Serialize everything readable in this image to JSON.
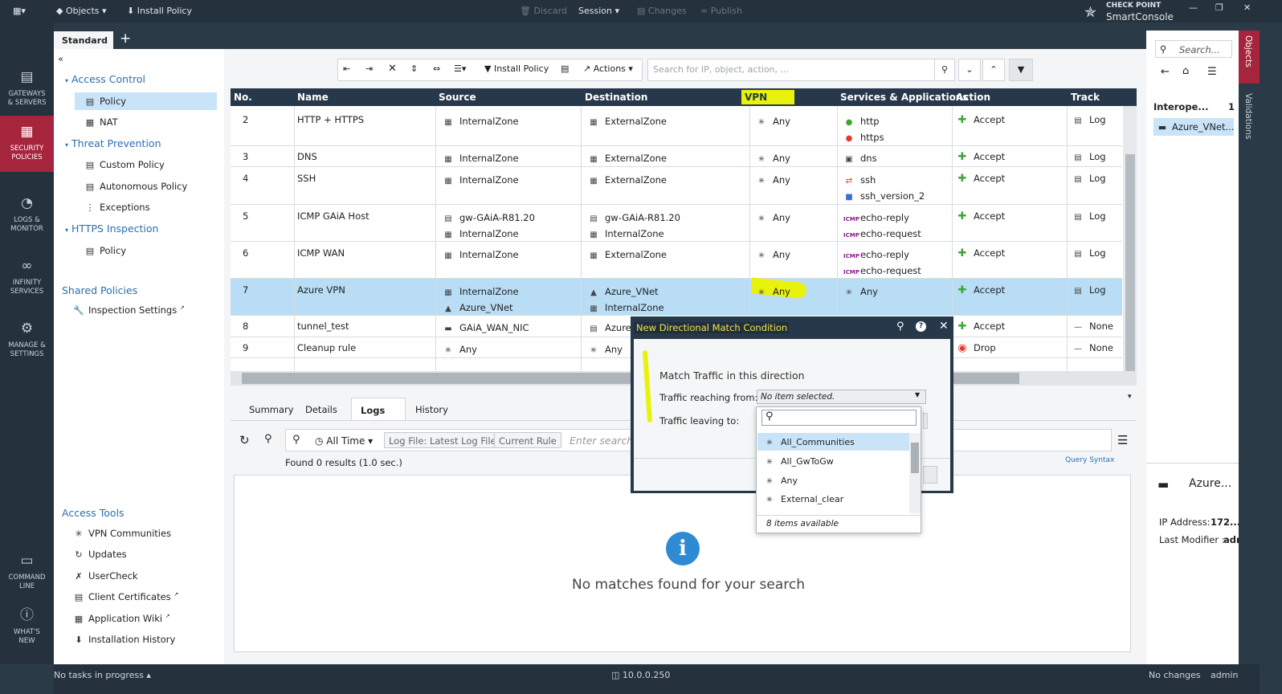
{
  "topbar": {
    "objects": "Objects",
    "install_policy": "Install Policy",
    "discard": "Discard",
    "session": "Session",
    "changes": "Changes",
    "publish": "Publish",
    "brand_top": "CHECK POINT",
    "brand_bottom": "SmartConsole"
  },
  "nav": [
    {
      "l1": "GATEWAYS",
      "l2": "& SERVERS",
      "icon": "servers-icon"
    },
    {
      "l1": "SECURITY",
      "l2": "POLICIES",
      "icon": "policies-icon"
    },
    {
      "l1": "LOGS &",
      "l2": "MONITOR",
      "icon": "monitor-icon"
    },
    {
      "l1": "INFINITY",
      "l2": "SERVICES",
      "icon": "infinity-icon"
    },
    {
      "l1": "MANAGE &",
      "l2": "SETTINGS",
      "icon": "gear-icon"
    },
    {
      "l1": "COMMAND",
      "l2": "LINE",
      "icon": "terminal-icon"
    },
    {
      "l1": "WHAT'S",
      "l2": "NEW",
      "icon": "question-icon"
    }
  ],
  "tab": {
    "label": "Standard",
    "add": "+"
  },
  "tree": {
    "access_control": "Access Control",
    "policy": "Policy",
    "nat": "NAT",
    "threat_prevention": "Threat Prevention",
    "custom_policy": "Custom Policy",
    "autonomous_policy": "Autonomous Policy",
    "exceptions": "Exceptions",
    "https_inspection": "HTTPS Inspection",
    "https_policy": "Policy",
    "shared_policies": "Shared Policies",
    "inspection_settings": "Inspection Settings",
    "access_tools": "Access Tools",
    "vpn_communities": "VPN Communities",
    "updates": "Updates",
    "usercheck": "UserCheck",
    "client_certificates": "Client Certificates",
    "application_wiki": "Application Wiki",
    "installation_history": "Installation History"
  },
  "toolbar": {
    "install_policy": "Install Policy",
    "actions": "Actions",
    "search_placeholder": "Search for IP, object, action, ..."
  },
  "grid": {
    "headers": [
      "No.",
      "Name",
      "Source",
      "Destination",
      "VPN",
      "Services & Applications",
      "Action",
      "Track"
    ],
    "rows": [
      {
        "no": "2",
        "name": "HTTP + HTTPS",
        "src": [
          "InternalZone"
        ],
        "dst": [
          "ExternalZone"
        ],
        "vpn": "Any",
        "svc": [
          "http",
          "https"
        ],
        "action": "Accept",
        "track": "Log"
      },
      {
        "no": "3",
        "name": "DNS",
        "src": [
          "InternalZone"
        ],
        "dst": [
          "ExternalZone"
        ],
        "vpn": "Any",
        "svc": [
          "dns"
        ],
        "action": "Accept",
        "track": "Log"
      },
      {
        "no": "4",
        "name": "SSH",
        "src": [
          "InternalZone"
        ],
        "dst": [
          "ExternalZone"
        ],
        "vpn": "Any",
        "svc": [
          "ssh",
          "ssh_version_2"
        ],
        "action": "Accept",
        "track": "Log"
      },
      {
        "no": "5",
        "name": "ICMP GAiA Host",
        "src": [
          "gw-GAiA-R81.20",
          "InternalZone"
        ],
        "dst": [
          "gw-GAiA-R81.20",
          "InternalZone"
        ],
        "vpn": "Any",
        "svc": [
          "echo-reply",
          "echo-request"
        ],
        "action": "Accept",
        "track": "Log"
      },
      {
        "no": "6",
        "name": "ICMP WAN",
        "src": [
          "InternalZone"
        ],
        "dst": [
          "ExternalZone"
        ],
        "vpn": "Any",
        "svc": [
          "echo-reply",
          "echo-request"
        ],
        "action": "Accept",
        "track": "Log"
      },
      {
        "no": "7",
        "name": "Azure VPN",
        "src": [
          "InternalZone",
          "Azure_VNet"
        ],
        "dst": [
          "Azure_VNet",
          "InternalZone"
        ],
        "vpn": "Any",
        "svc": [
          "Any"
        ],
        "action": "Accept",
        "track": "Log"
      },
      {
        "no": "8",
        "name": "tunnel_test",
        "src": [
          "GAiA_WAN_NIC"
        ],
        "dst": [
          "Azure_"
        ],
        "vpn": "",
        "svc": [],
        "action": "Accept",
        "track": "None"
      },
      {
        "no": "9",
        "name": "Cleanup rule",
        "src": [
          "Any"
        ],
        "dst": [
          "Any"
        ],
        "vpn": "",
        "svc": [],
        "action": "Drop",
        "track": "None"
      }
    ]
  },
  "lower": {
    "tabs": [
      "Summary",
      "Details",
      "Logs",
      "History"
    ],
    "time_filter": "All Time",
    "chip1": "Log File: Latest Log File",
    "chip2": "Current Rule",
    "search_placeholder": "Enter search",
    "found": "Found 0 results (1.0 sec.)",
    "query_syntax": "Query Syntax",
    "no_matches": "No matches found for your search",
    "info_glyph": "i"
  },
  "dialog": {
    "title": "New Directional Match Condition",
    "heading": "Match Traffic in this direction",
    "from_label": "Traffic reaching from:",
    "from_value": "No item selected.",
    "to_label": "Traffic leaving to:"
  },
  "dropdown": {
    "items": [
      "All_Communities",
      "All_GwToGw",
      "Any",
      "External_clear"
    ],
    "footer": "8 items available"
  },
  "right": {
    "search_placeholder": "Search...",
    "interop": "Interope...",
    "interop_count": "1",
    "selected_item": "Azure_VNet...",
    "detail_title": "Azure...",
    "ip_label": "IP Address:",
    "ip_value": "172....",
    "modifier_label": "Last Modifier :",
    "modifier_value": "adm",
    "strip_objects": "Objects",
    "strip_validations": "Validations"
  },
  "status": {
    "tasks": "No tasks in progress",
    "server": "10.0.0.250",
    "changes": "No changes",
    "user": "admin"
  },
  "colors": {
    "nav_active": "#a7243d",
    "header": "#26384a",
    "accept": "#3ea534",
    "drop": "#e03c31",
    "selection": "#b8ddf5",
    "highlight": "#e9f20c"
  }
}
